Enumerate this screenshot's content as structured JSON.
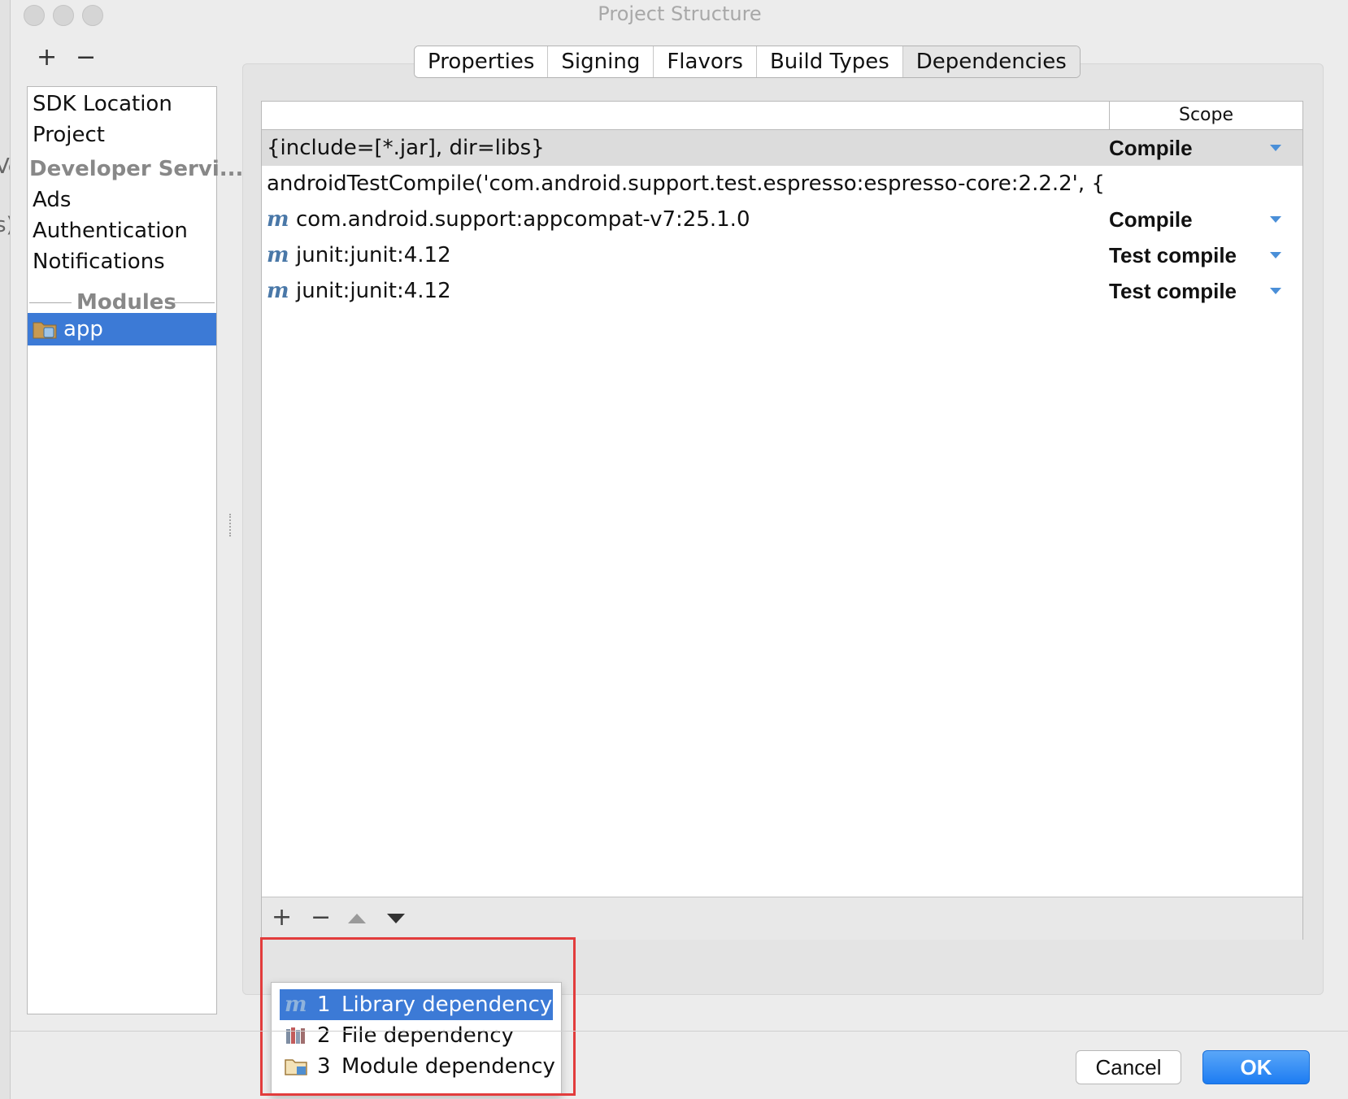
{
  "window": {
    "title": "Project Structure"
  },
  "background_fragments": [
    "Ve",
    "s)"
  ],
  "left_toolbar": {
    "add_label": "+",
    "remove_label": "−"
  },
  "left_list": {
    "items": [
      {
        "label": "SDK Location"
      },
      {
        "label": "Project"
      },
      {
        "label": "Developer Servi..."
      },
      {
        "label": "Ads"
      },
      {
        "label": "Authentication"
      },
      {
        "label": "Notifications"
      }
    ],
    "modules_header": "Modules",
    "module": "app"
  },
  "tabs": [
    {
      "label": "Properties"
    },
    {
      "label": "Signing"
    },
    {
      "label": "Flavors"
    },
    {
      "label": "Build Types"
    },
    {
      "label": "Dependencies",
      "active": true
    }
  ],
  "table": {
    "scope_header": "Scope",
    "rows": [
      {
        "dependency": "{include=[*.jar], dir=libs}",
        "scope": "Compile",
        "icon": "none",
        "selected": true
      },
      {
        "dependency": "androidTestCompile('com.android.support.test.espresso:espresso-core:2.2.2', {",
        "scope": "",
        "icon": "none"
      },
      {
        "dependency": "com.android.support:appcompat-v7:25.1.0",
        "scope": "Compile",
        "icon": "maven-m-icon"
      },
      {
        "dependency": "junit:junit:4.12",
        "scope": "Test compile",
        "icon": "maven-m-icon"
      },
      {
        "dependency": "junit:junit:4.12",
        "scope": "Test compile",
        "icon": "maven-m-icon"
      }
    ],
    "m_glyph": "m"
  },
  "table_toolbar": {
    "add_label": "+",
    "remove_label": "−"
  },
  "popup_menu": [
    {
      "num": "1",
      "label": "Library dependency",
      "icon": "maven-m-icon",
      "selected": true
    },
    {
      "num": "2",
      "label": "File dependency",
      "icon": "jar-file-icon"
    },
    {
      "num": "3",
      "label": "Module dependency",
      "icon": "module-folder-icon"
    }
  ],
  "buttons": {
    "cancel": "Cancel",
    "ok": "OK"
  },
  "colors": {
    "selection": "#3c7ad6",
    "ok_button": "#1d7cf2",
    "highlight_box": "#e23c3c",
    "scope_arrow": "#4a8fd8"
  }
}
